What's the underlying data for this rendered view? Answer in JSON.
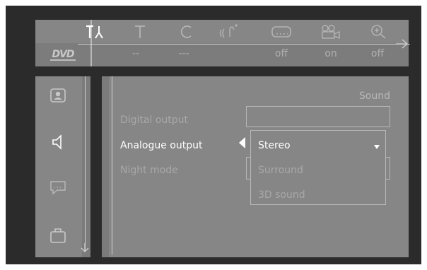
{
  "top_bar": {
    "disc_label": "DVD",
    "icons": [
      {
        "name": "setup-icon",
        "glyph": "T⅄",
        "active": true
      },
      {
        "name": "title-icon",
        "glyph": "T",
        "active": false
      },
      {
        "name": "chapter-icon",
        "glyph": "C",
        "active": false
      },
      {
        "name": "audio-icon",
        "glyph": "((ʅ̃",
        "active": false
      },
      {
        "name": "subtitle-icon",
        "glyph": "....",
        "active": false
      },
      {
        "name": "angle-icon",
        "glyph": "⚆⚆",
        "active": false
      },
      {
        "name": "zoom-icon",
        "glyph": "⊕",
        "active": false
      }
    ],
    "values": [
      "--",
      "---",
      "off",
      "on",
      "off"
    ]
  },
  "sidebar": {
    "items": [
      {
        "name": "picture-icon"
      },
      {
        "name": "speaker-icon"
      },
      {
        "name": "language-icon"
      },
      {
        "name": "features-icon"
      }
    ]
  },
  "panel": {
    "title": "Sound",
    "rows": [
      {
        "label": "Digital output",
        "active": false
      },
      {
        "label": "Analogue output",
        "active": true
      },
      {
        "label": "Night mode",
        "active": false
      }
    ],
    "dropdown": {
      "selected": "Stereo",
      "options": [
        "Stereo",
        "Surround",
        "3D sound"
      ]
    }
  },
  "colors": {
    "screen_bg": "#2b2b2b",
    "panel_bg": "#868686",
    "active_text": "#ffffff",
    "inactive_text": "#a8a8a8"
  }
}
